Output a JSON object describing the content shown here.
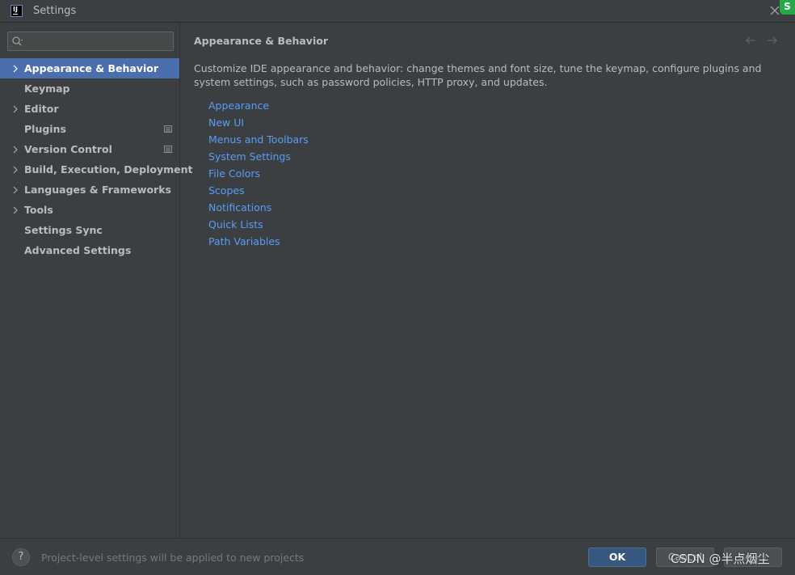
{
  "window": {
    "title": "Settings",
    "app_icon_text": "IJ",
    "corner_badge": "S"
  },
  "search": {
    "value": "",
    "placeholder": ""
  },
  "sidebar": {
    "items": [
      {
        "label": "Appearance & Behavior",
        "expandable": true,
        "selected": true,
        "badge": false
      },
      {
        "label": "Keymap",
        "expandable": false,
        "selected": false,
        "badge": false
      },
      {
        "label": "Editor",
        "expandable": true,
        "selected": false,
        "badge": false
      },
      {
        "label": "Plugins",
        "expandable": false,
        "selected": false,
        "badge": true
      },
      {
        "label": "Version Control",
        "expandable": true,
        "selected": false,
        "badge": true
      },
      {
        "label": "Build, Execution, Deployment",
        "expandable": true,
        "selected": false,
        "badge": false
      },
      {
        "label": "Languages & Frameworks",
        "expandable": true,
        "selected": false,
        "badge": false
      },
      {
        "label": "Tools",
        "expandable": true,
        "selected": false,
        "badge": false
      },
      {
        "label": "Settings Sync",
        "expandable": false,
        "selected": false,
        "badge": false
      },
      {
        "label": "Advanced Settings",
        "expandable": false,
        "selected": false,
        "badge": false
      }
    ]
  },
  "main": {
    "title": "Appearance & Behavior",
    "description": "Customize IDE appearance and behavior: change themes and font size, tune the keymap, configure plugins and system settings, such as password policies, HTTP proxy, and updates.",
    "links": [
      "Appearance",
      "New UI",
      "Menus and Toolbars",
      "System Settings",
      "File Colors",
      "Scopes",
      "Notifications",
      "Quick Lists",
      "Path Variables"
    ]
  },
  "footer": {
    "help_label": "?",
    "note": "Project-level settings will be applied to new projects",
    "ok_label": "OK",
    "cancel_label": "Cancel",
    "apply_label": "Apply",
    "watermark": "CSDN @半点烟尘"
  },
  "colors": {
    "background": "#3c3f41",
    "selection": "#4b6eaf",
    "link": "#589df6",
    "text": "#bbbbbb",
    "primary_button": "#365880"
  },
  "icons": {
    "close": "close-icon",
    "search": "search-icon",
    "chevron": "chevron-right-icon",
    "badge": "project-level-icon",
    "back": "arrow-left-icon",
    "forward": "arrow-right-icon"
  }
}
